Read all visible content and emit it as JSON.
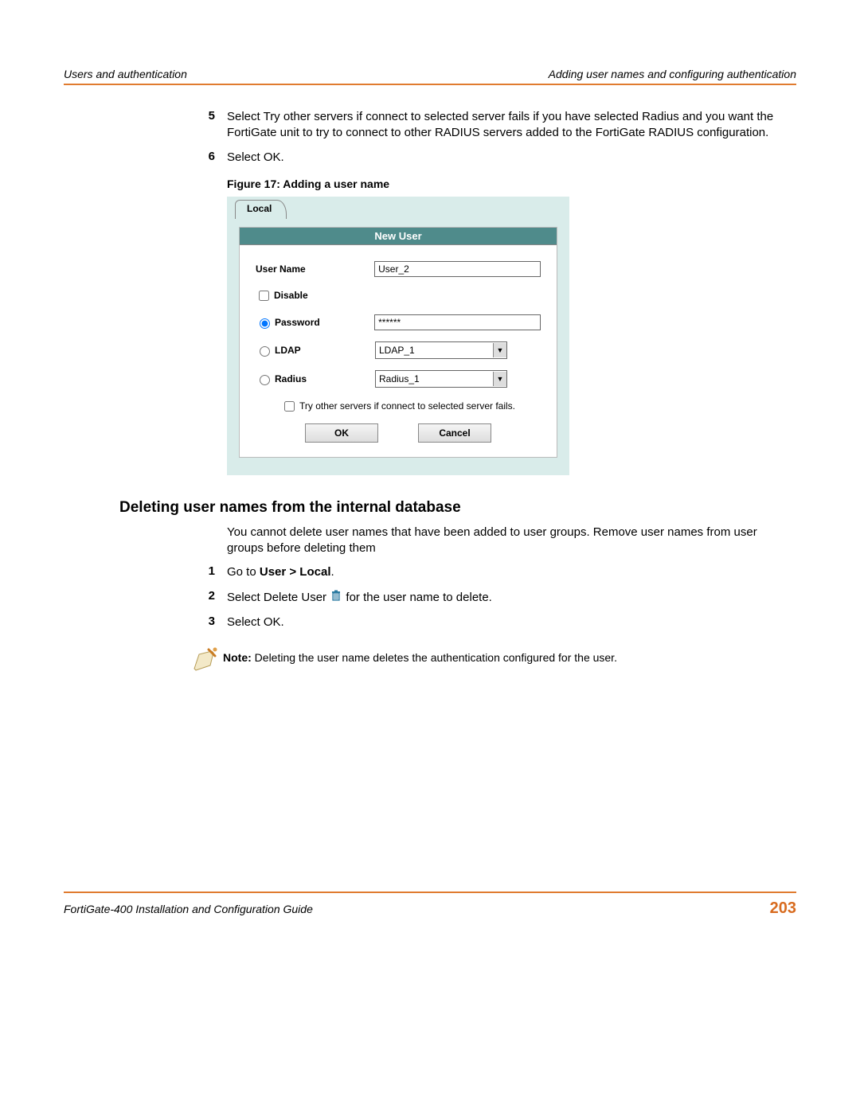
{
  "header": {
    "left": "Users and authentication",
    "right": "Adding user names and configuring authentication"
  },
  "steps_top": [
    {
      "num": "5",
      "text": "Select Try other servers if connect to selected server fails if you have selected Radius and you want the FortiGate unit to try to connect to other RADIUS servers added to the FortiGate RADIUS configuration."
    },
    {
      "num": "6",
      "text": "Select OK."
    }
  ],
  "figure_caption": "Figure 17: Adding a user name",
  "form": {
    "tab": "Local",
    "title": "New User",
    "user_name_label": "User Name",
    "user_name_value": "User_2",
    "disable_label": "Disable",
    "password_label": "Password",
    "password_value": "******",
    "ldap_label": "LDAP",
    "ldap_value": "LDAP_1",
    "radius_label": "Radius",
    "radius_value": "Radius_1",
    "try_other": "Try other servers if connect to selected server fails.",
    "ok": "OK",
    "cancel": "Cancel"
  },
  "section_heading": "Deleting user names from the internal database",
  "delete_intro": "You cannot delete user names that have been added to user groups. Remove user names from user groups before deleting them",
  "delete_steps": {
    "s1_pre": "Go to ",
    "s1_bold": "User > Local",
    "s1_post": ".",
    "s2_pre": "Select Delete User ",
    "s2_post": " for the user name to delete.",
    "s3": "Select OK."
  },
  "note_label": "Note:",
  "note_text": " Deleting the user name deletes the authentication configured for the user.",
  "footer": {
    "left": "FortiGate-400 Installation and Configuration Guide",
    "page": "203"
  }
}
